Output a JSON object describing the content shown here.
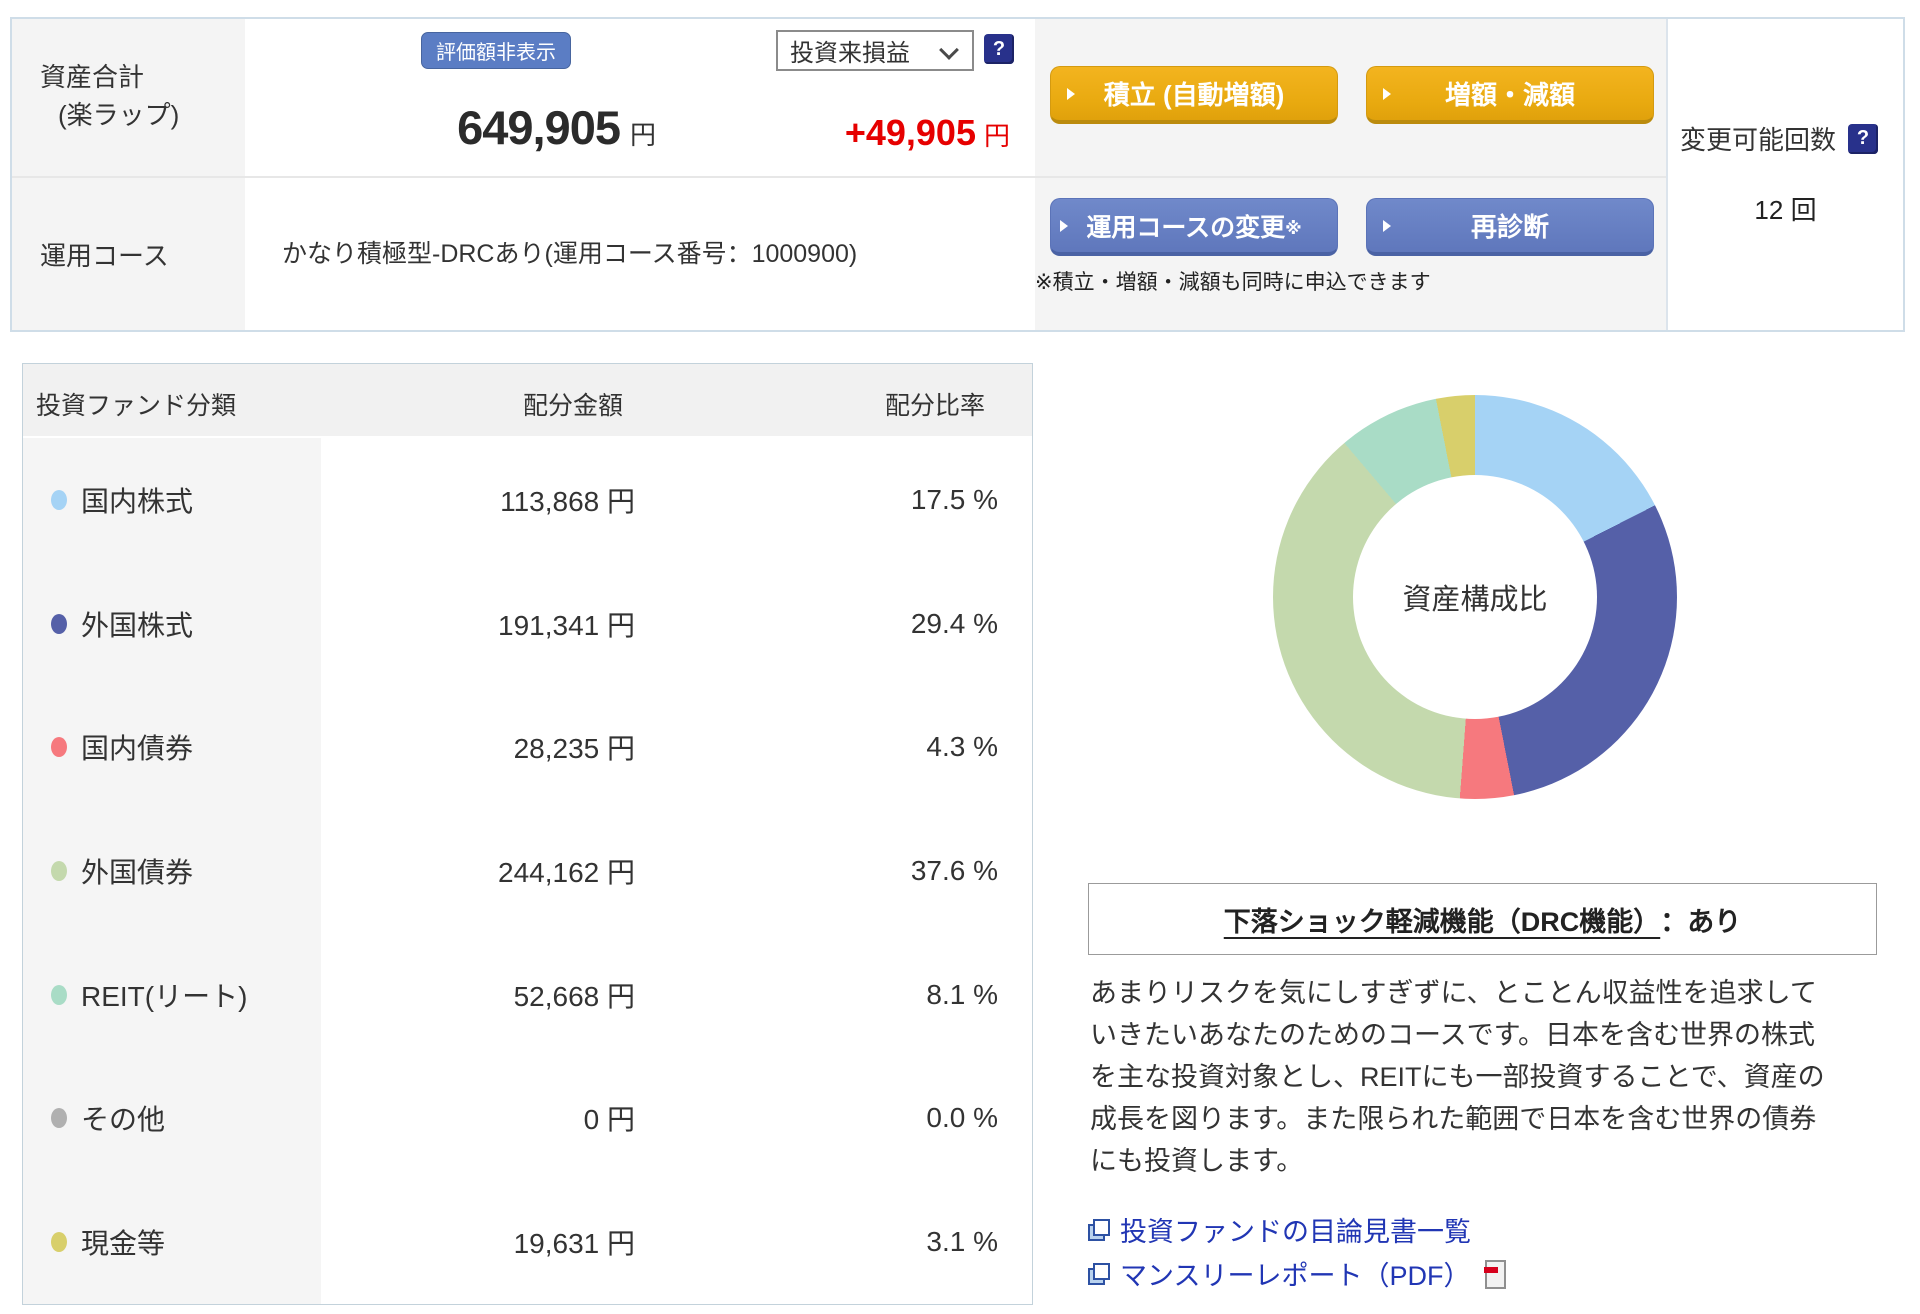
{
  "summary": {
    "asset_total_label": "資産合計",
    "asset_total_sublabel": "(楽ラップ)",
    "hide_value_button": "評価額非表示",
    "total_amount": "649,905",
    "total_unit": "円",
    "pl_dropdown_value": "投資来損益",
    "pl_amount": "+49,905",
    "pl_unit": "円",
    "help_glyph": "?",
    "buttons": {
      "tsumitate": "積立 (自動増額)",
      "zougen": "増額・減額",
      "course_change": "運用コースの変更",
      "course_change_note_mark": "※",
      "rediagnose": "再診断"
    },
    "course_label": "運用コース",
    "course_value": "かなり積極型-DRCあり(運用コース番号：1000900)",
    "note": "※積立・増額・減額も同時に申込できます",
    "changes": {
      "label": "変更可能回数",
      "value": "12 回",
      "help_glyph": "?"
    }
  },
  "table": {
    "headers": [
      "投資ファンド分類",
      "配分金額",
      "配分比率"
    ],
    "rows": [
      {
        "label": "国内株式",
        "color": "#a5d3f5",
        "amount": "113,868 円",
        "ratio": "17.5 %"
      },
      {
        "label": "外国株式",
        "color": "#5560a8",
        "amount": "191,341 円",
        "ratio": "29.4 %"
      },
      {
        "label": "国内債券",
        "color": "#f6797e",
        "amount": "28,235 円",
        "ratio": "4.3 %"
      },
      {
        "label": "外国債券",
        "color": "#c4d9ad",
        "amount": "244,162 円",
        "ratio": "37.6 %"
      },
      {
        "label": "REIT(リート)",
        "color": "#a9dcc6",
        "amount": "52,668 円",
        "ratio": "8.1 %"
      },
      {
        "label": "その他",
        "color": "#b0b0b0",
        "amount": "0 円",
        "ratio": "0.0 %"
      },
      {
        "label": "現金等",
        "color": "#d8cf6b",
        "amount": "19,631 円",
        "ratio": "3.1 %"
      }
    ]
  },
  "chart_data": {
    "type": "pie",
    "style": "donut",
    "center_label": "資産構成比",
    "start_angle_deg": 0,
    "direction": "clockwise",
    "segments": [
      {
        "label": "国内株式",
        "value_yen": 113868,
        "pct": 17.5,
        "color": "#a5d3f5"
      },
      {
        "label": "外国株式",
        "value_yen": 191341,
        "pct": 29.4,
        "color": "#5560a8"
      },
      {
        "label": "国内債券",
        "value_yen": 28235,
        "pct": 4.3,
        "color": "#f6797e"
      },
      {
        "label": "外国債券",
        "value_yen": 244162,
        "pct": 37.6,
        "color": "#c4d9ad"
      },
      {
        "label": "REIT(リート)",
        "value_yen": 52668,
        "pct": 8.1,
        "color": "#a9dcc6"
      },
      {
        "label": "その他",
        "value_yen": 0,
        "pct": 0.0,
        "color": "#b0b0b0"
      },
      {
        "label": "現金等",
        "value_yen": 19631,
        "pct": 3.1,
        "color": "#d8cf6b"
      }
    ]
  },
  "drc": {
    "title_link": "下落ショック軽減機能（DRC機能）",
    "title_suffix": "：あり",
    "description": "あまりリスクを気にしすぎずに、とことん収益性を追求して\nいきたいあなたのためのコースです。日本を含む世界の株式\nを主な投資対象とし、REITにも一部投資することで、資産の\n成長を図ります。また限られた範囲で日本を含む世界の債券\nにも投資します。"
  },
  "links": {
    "prospectus": "投資ファンドの目論見書一覧",
    "monthly_report": "マンスリーレポート（PDF）"
  }
}
